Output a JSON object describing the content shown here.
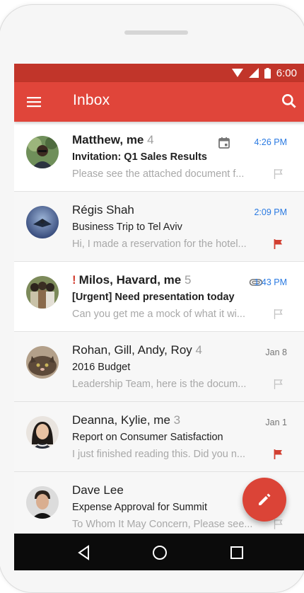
{
  "status": {
    "time": "6:00"
  },
  "app_bar": {
    "title": "Inbox",
    "accent": "#e0453a",
    "status_color": "#c1352a"
  },
  "emails": [
    {
      "sender": "Matthew, me",
      "count": "4",
      "subject": "Invitation: Q1 Sales Results",
      "snippet": "Please see the attached document f...",
      "time": "4:26 PM",
      "icon": "calendar-icon",
      "flag": "outline",
      "unread": true
    },
    {
      "sender": "Régis Shah",
      "count": "",
      "subject": "Business Trip to Tel Aviv",
      "snippet": "Hi, I made a reservation for the hotel...",
      "time": "2:09 PM",
      "icon": "",
      "flag": "red",
      "unread": false
    },
    {
      "sender": "Milos, Havard, me",
      "count": "5",
      "important": "!",
      "subject": "[Urgent] Need presentation today",
      "snippet": "Can you get me a mock of what it wi...",
      "time": "1:43 PM",
      "icon": "attachment-icon",
      "flag": "outline",
      "unread": true
    },
    {
      "sender": "Rohan, Gill, Andy, Roy",
      "count": "4",
      "subject": "2016 Budget",
      "snippet": "Leadership Team, here is the docum...",
      "time": "Jan 8",
      "icon": "",
      "flag": "outline",
      "unread": false
    },
    {
      "sender": "Deanna, Kylie, me",
      "count": "3",
      "subject": "Report on Consumer Satisfaction",
      "snippet": "I just finished reading this. Did you n...",
      "time": "Jan 1",
      "icon": "",
      "flag": "red",
      "unread": false
    },
    {
      "sender": "Dave Lee",
      "count": "",
      "subject": "Expense Approval for Summit",
      "snippet": "To Whom It May Concern, Please see...",
      "time": "",
      "icon": "",
      "flag": "outline",
      "unread": false
    }
  ],
  "fab": {
    "icon": "pencil-icon",
    "color": "#db4437"
  },
  "nav": {
    "back": "back-icon",
    "home": "home-icon",
    "recents": "recents-icon"
  }
}
